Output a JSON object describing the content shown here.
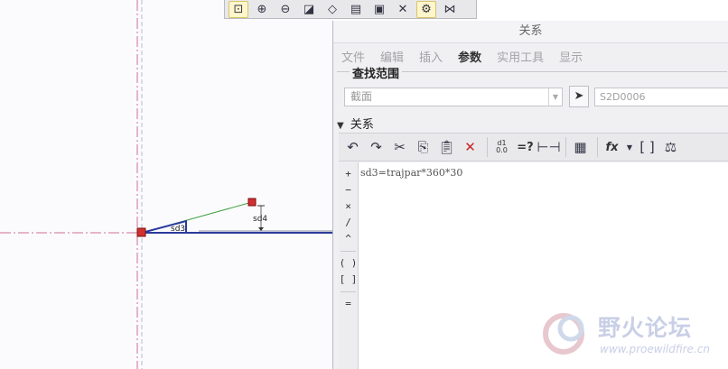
{
  "toolbar_top": {
    "buttons": [
      "zoom-fit",
      "zoom-in",
      "zoom-out",
      "repaint",
      "view-orient",
      "saved-views",
      "display-style",
      "datum-display",
      "sketch-display",
      "constraint-display"
    ]
  },
  "canvas": {
    "dimension_labels": [
      "sd3",
      "sd4"
    ]
  },
  "dialog": {
    "title": "关系",
    "menu": [
      "文件",
      "编辑",
      "插入",
      "参数",
      "实用工具",
      "显示"
    ],
    "active_menu": "参数",
    "lookup": {
      "label": "查找范围",
      "scope_value": "截面",
      "id_value": "S2D0006"
    },
    "relations_label": "关系",
    "toolbar": {
      "unit_small_top": "d1",
      "unit_small_bottom": "0.0",
      "verify_label": "=?",
      "function_label": "fx"
    },
    "operators": [
      "+",
      "−",
      "×",
      "/",
      "^",
      "( )",
      "[ ]",
      "="
    ],
    "relation_text": "sd3=trajpar*360*30"
  },
  "watermark": {
    "title": "野火论坛",
    "url": "www.proewildfire.cn"
  },
  "colors": {
    "centerline": "#d06e94",
    "sketch_blue": "#2b3a9c",
    "sketch_green": "#43a043",
    "point_red": "#d22f2f"
  }
}
